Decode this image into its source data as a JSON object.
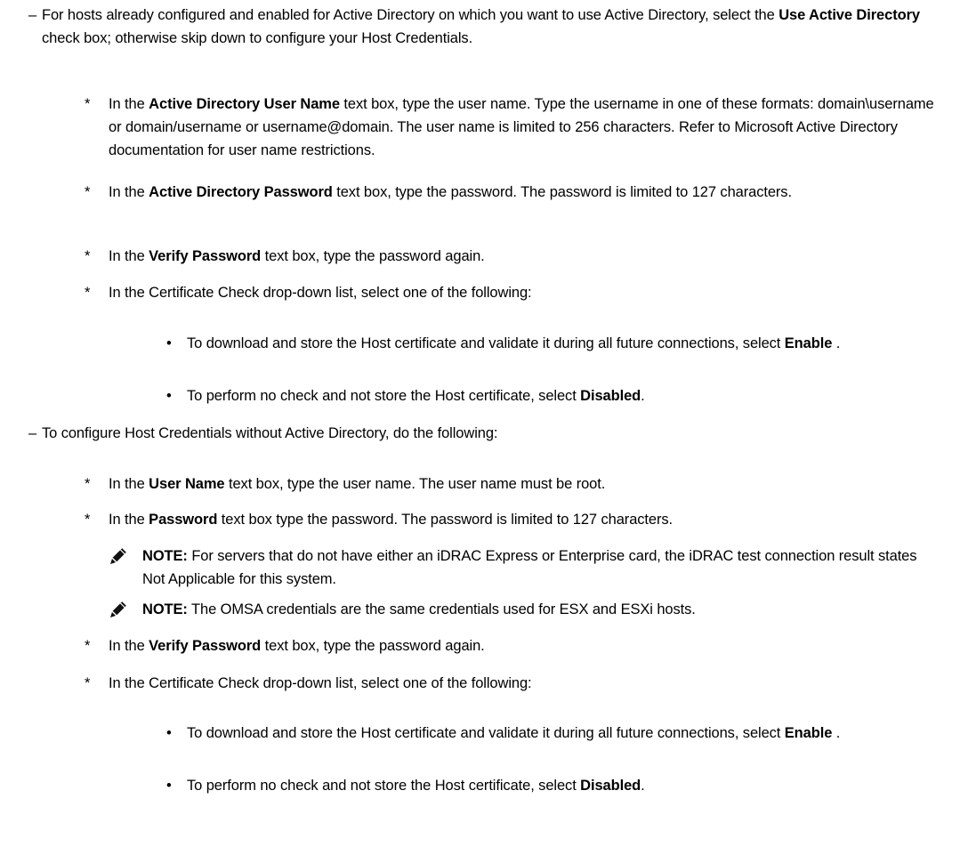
{
  "items": [
    {
      "marker": "–",
      "parts": [
        [
          "For hosts already configured and enabled for Active Directory on which you want to use Active Directory, select the ",
          false
        ],
        [
          "Use Active Directory",
          true
        ],
        [
          " check box; otherwise skip down to configure your Host Credentials.",
          false
        ]
      ]
    },
    {
      "marker": "*",
      "parts": [
        [
          "In the ",
          false
        ],
        [
          "Active Directory User Name",
          true
        ],
        [
          " text box, type the user name. Type the username in one of these formats: domain\\username or domain/username or username@domain. The user name is limited to 256 characters. Refer to Microsoft Active Directory documentation for user name restrictions.",
          false
        ]
      ]
    },
    {
      "marker": "*",
      "parts": [
        [
          "In the ",
          false
        ],
        [
          "Active Directory Password",
          true
        ],
        [
          " text box, type the password. The password is limited to 127 characters.",
          false
        ]
      ]
    },
    {
      "marker": "*",
      "parts": [
        [
          "In the ",
          false
        ],
        [
          "Verify Password",
          true
        ],
        [
          " text box, type the password again.",
          false
        ]
      ]
    },
    {
      "marker": "*",
      "parts": [
        [
          "In the Certificate Check drop-down list, select one of the following:",
          false
        ]
      ]
    },
    {
      "marker": "•",
      "parts": [
        [
          "To download and store the Host certificate and validate it during all future connections, select ",
          false
        ],
        [
          "Enable",
          true
        ],
        [
          " .",
          false
        ]
      ]
    },
    {
      "marker": "•",
      "parts": [
        [
          "To perform no check and not store the Host certificate, select ",
          false
        ],
        [
          "Disabled",
          true
        ],
        [
          ".",
          false
        ]
      ]
    },
    {
      "marker": "–",
      "parts": [
        [
          "To configure Host Credentials without Active Directory, do the following:",
          false
        ]
      ]
    },
    {
      "marker": "*",
      "parts": [
        [
          "In the ",
          false
        ],
        [
          "User Name",
          true
        ],
        [
          " text box, type the user name. The user name must be root.",
          false
        ]
      ]
    },
    {
      "marker": "*",
      "parts": [
        [
          "In the ",
          false
        ],
        [
          "Password",
          true
        ],
        [
          " text box type the password. The password is limited to 127 characters.",
          false
        ]
      ]
    },
    {
      "marker": "",
      "parts": [
        [
          "NOTE:",
          true
        ],
        [
          " For servers that do not have either an iDRAC Express or Enterprise card, the iDRAC test connection result states Not Applicable for this system.",
          false
        ]
      ]
    },
    {
      "marker": "",
      "parts": [
        [
          "NOTE:",
          true
        ],
        [
          " The OMSA credentials are the same credentials used for ESX and ESXi hosts.",
          false
        ]
      ]
    },
    {
      "marker": "*",
      "parts": [
        [
          "In the ",
          false
        ],
        [
          "Verify Password",
          true
        ],
        [
          " text box, type the password again.",
          false
        ]
      ]
    },
    {
      "marker": "*",
      "parts": [
        [
          "In the Certificate Check drop-down list, select one of the following:",
          false
        ]
      ]
    },
    {
      "marker": "•",
      "parts": [
        [
          "To download and store the Host certificate and validate it during all future connections, select ",
          false
        ],
        [
          "Enable",
          true
        ],
        [
          " .",
          false
        ]
      ]
    },
    {
      "marker": "•",
      "parts": [
        [
          "To perform no check and not store the Host certificate, select ",
          false
        ],
        [
          "Disabled",
          true
        ],
        [
          ".",
          false
        ]
      ]
    }
  ]
}
